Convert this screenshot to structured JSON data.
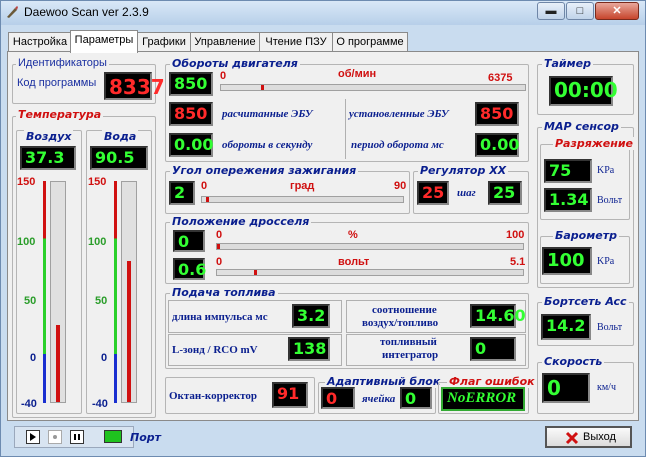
{
  "window": {
    "title": "Daewoo Scan ver 2.3.9",
    "minimize": "▬",
    "maximize": "□",
    "close": "✕"
  },
  "tabs": [
    {
      "label": "Настройка"
    },
    {
      "label": "Параметры"
    },
    {
      "label": "Графики"
    },
    {
      "label": "Управление"
    },
    {
      "label": "Чтение ПЗУ"
    },
    {
      "label": "О программе"
    }
  ],
  "identifiers": {
    "title": "Идентификаторы",
    "program_code_label": "Код программы",
    "program_code": "8337"
  },
  "temperature": {
    "title": "Температура",
    "air": {
      "label": "Воздух",
      "value": "37.3",
      "level": 0.35
    },
    "water": {
      "label": "Вода",
      "value": "90.5",
      "level": 0.64
    },
    "scale": [
      "150",
      "100",
      "50",
      "0",
      "-40"
    ]
  },
  "rpm": {
    "title": "Обороты двигателя",
    "value": "850",
    "unit": "об/мин",
    "min": "0",
    "max": "6375",
    "level": 0.13,
    "calc_value": "850",
    "calc_label": "расчитанные ЭБУ",
    "set_label": "установленные ЭБУ",
    "set_value": "850",
    "rps_value": "0.00",
    "rps_label": "обороты в секунду",
    "period_label": "период оборота  мс",
    "period_value": "0.00"
  },
  "ignition": {
    "title": "Угол опережения зажигания",
    "value": "2",
    "min": "0",
    "unit": "град",
    "max": "90",
    "level": 0.02
  },
  "idle_regulator": {
    "title": "Регулятор XX",
    "value_left": "25",
    "step_label": "шаг",
    "step_value": "25"
  },
  "throttle": {
    "title": "Положение дросселя",
    "percent_value": "0",
    "percent_min": "0",
    "percent_unit": "%",
    "percent_max": "100",
    "percent_level": 0.0,
    "volt_value": "0.6",
    "volt_min": "0",
    "volt_unit": "вольт",
    "volt_max": "5.1",
    "volt_level": 0.12
  },
  "fuel": {
    "title": "Подача топлива",
    "pulse_label": "длина импульса  мс",
    "pulse_value": "3.2",
    "ratio_label_1": "соотношение",
    "ratio_label_2": "воздух/топливо",
    "ratio_value": "14.60",
    "lambda_label": "L-зонд / RCO  mV",
    "lambda_value": "138",
    "integrator_label_1": "топливный",
    "integrator_label_2": "интегратор",
    "integrator_value": "0"
  },
  "octane": {
    "label": "Октан-корректор",
    "value": "91"
  },
  "adaptive": {
    "title": "Адаптивный блок",
    "value": "0",
    "cell_label": "ячейка",
    "cell_value": "0"
  },
  "errors": {
    "title": "Флаг ошибок",
    "value": "NoERROR"
  },
  "timer": {
    "title": "Таймер",
    "value": "00:00"
  },
  "map": {
    "title": "MAP сенсор",
    "vacuum_title": "Разряжение",
    "kpa_value": "75",
    "kpa_unit": "KPa",
    "volt_value": "1.34",
    "volt_unit": "Вольт",
    "baro_title": "Барометр",
    "baro_value": "100",
    "baro_unit": "KPa"
  },
  "battery": {
    "title": "Бортсеть Acc",
    "value": "14.2",
    "unit": "Вольт"
  },
  "speed": {
    "title": "Скорость",
    "value": "0",
    "unit": "км/ч"
  },
  "bottom": {
    "port_label": "Порт",
    "exit_label": "Выход"
  },
  "colors": {
    "accent_blue": "#0a1f8f",
    "alert_red": "#d01010",
    "lcd_green": "#33ff33"
  }
}
